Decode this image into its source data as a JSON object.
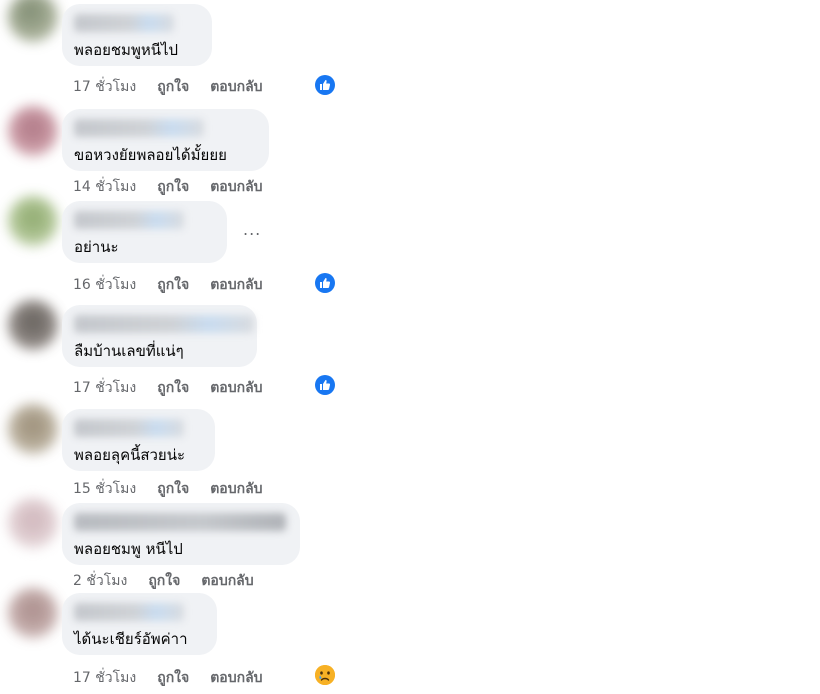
{
  "actions": {
    "like": "ถูกใจ",
    "reply": "ตอบกลับ"
  },
  "more_label": "...",
  "comments": [
    {
      "text": "พลอยชมพูหนีไป",
      "time": "17 ชั่วโมง",
      "reaction": "like-icon"
    },
    {
      "text": "ขอหวงยัยพลอยได้มั้ยยย",
      "time": "14 ชั่วโมง",
      "reaction": ""
    },
    {
      "text": "อย่านะ",
      "time": "16 ชั่วโมง",
      "reaction": "like-icon"
    },
    {
      "text": "ลืมบ้านเลขที่แน่ๆ",
      "time": "17 ชั่วโมง",
      "reaction": "like-icon"
    },
    {
      "text": "พลอยลุคนี้สวยน่ะ",
      "time": "15 ชั่วโมง",
      "reaction": ""
    },
    {
      "text": "พลอยชมพู หนีไป",
      "time": "2 ชั่วโมง",
      "reaction": ""
    },
    {
      "text": "ได้นะเชียร์อัพค่าา",
      "time": "17 ชั่วโมง",
      "reaction": "crying-face-icon"
    }
  ],
  "colors": {
    "bubble": "#f0f2f5",
    "meta": "#65676b",
    "like": "#1877f2",
    "sad": "#f7b125"
  }
}
